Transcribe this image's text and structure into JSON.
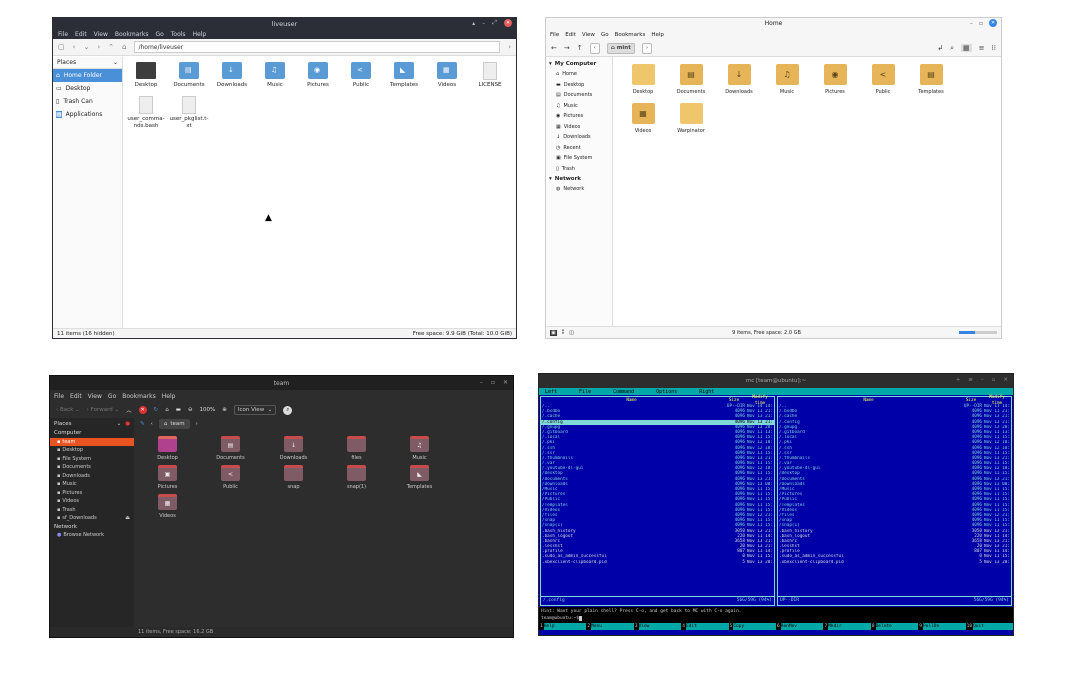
{
  "w1": {
    "title": "liveuser",
    "menu": [
      "File",
      "Edit",
      "View",
      "Bookmarks",
      "Go",
      "Tools",
      "Help"
    ],
    "path": "/home/liveuser",
    "places_label": "Places",
    "side": [
      "Home Folder",
      "Desktop",
      "Trash Can",
      "Applications"
    ],
    "items": [
      {
        "label": "Desktop",
        "kind": "dark"
      },
      {
        "label": "Documents",
        "kind": "folder",
        "glyph": "▤"
      },
      {
        "label": "Downloads",
        "kind": "folder",
        "glyph": "↓"
      },
      {
        "label": "Music",
        "kind": "folder",
        "glyph": "♫"
      },
      {
        "label": "Pictures",
        "kind": "folder",
        "glyph": "◉"
      },
      {
        "label": "Public",
        "kind": "folder",
        "glyph": "<"
      },
      {
        "label": "Templates",
        "kind": "folder",
        "glyph": "◣"
      },
      {
        "label": "Videos",
        "kind": "folder",
        "glyph": "▦"
      },
      {
        "label": "LICENSE",
        "kind": "doc"
      },
      {
        "label": "user_comma-nds.bash",
        "kind": "doc"
      },
      {
        "label": "user_pkglist.t-xt",
        "kind": "doc"
      }
    ],
    "status_left": "11 items (16 hidden)",
    "status_right": "Free space: 9.9 GiB (Total: 10.0 GiB)"
  },
  "w2": {
    "title": "Home",
    "menu": [
      "File",
      "Edit",
      "View",
      "Go",
      "Bookmarks",
      "Help"
    ],
    "crumb": "mint",
    "sections": [
      {
        "name": "My Computer",
        "items": [
          {
            "label": "Home",
            "icon": "home-icon",
            "glyph": "⌂"
          },
          {
            "label": "Desktop",
            "icon": "desktop-icon",
            "glyph": "▬"
          },
          {
            "label": "Documents",
            "icon": "documents-icon",
            "glyph": "▤"
          },
          {
            "label": "Music",
            "icon": "music-icon",
            "glyph": "♫"
          },
          {
            "label": "Pictures",
            "icon": "pictures-icon",
            "glyph": "◉"
          },
          {
            "label": "Videos",
            "icon": "videos-icon",
            "glyph": "▦"
          },
          {
            "label": "Downloads",
            "icon": "downloads-icon",
            "glyph": "↓"
          },
          {
            "label": "Recent",
            "icon": "recent-icon",
            "glyph": "◷"
          },
          {
            "label": "File System",
            "icon": "filesystem-icon",
            "glyph": "▣"
          },
          {
            "label": "Trash",
            "icon": "trash-icon",
            "glyph": "▯"
          }
        ]
      },
      {
        "name": "Network",
        "items": [
          {
            "label": "Network",
            "icon": "network-icon",
            "glyph": "◍"
          }
        ]
      }
    ],
    "items": [
      {
        "label": "Desktop",
        "glyph": ""
      },
      {
        "label": "Documents",
        "glyph": "▤"
      },
      {
        "label": "Downloads",
        "glyph": "↓"
      },
      {
        "label": "Music",
        "glyph": "♫"
      },
      {
        "label": "Pictures",
        "glyph": "◉"
      },
      {
        "label": "Public",
        "glyph": "<"
      },
      {
        "label": "Templates",
        "glyph": "▤"
      },
      {
        "label": "Videos",
        "glyph": "▦"
      },
      {
        "label": "Warpinator",
        "glyph": ""
      }
    ],
    "status": "9 items, Free space: 2.0 GB"
  },
  "w3": {
    "title": "team",
    "menu": [
      "File",
      "Edit",
      "View",
      "Go",
      "Bookmarks",
      "Help"
    ],
    "back": "Back",
    "forward": "Forward",
    "zoom": "100%",
    "view": "Icon View",
    "places_label": "Places",
    "tab": "team",
    "computer_label": "Computer",
    "side": [
      "team",
      "Desktop",
      "File System",
      "Documents",
      "Downloads",
      "Music",
      "Pictures",
      "Videos",
      "Trash",
      "sf_Downloads"
    ],
    "network_label": "Network",
    "network_item": "Browse Network",
    "items": [
      {
        "label": "Desktop",
        "glyph": "",
        "grad": true
      },
      {
        "label": "Documents",
        "glyph": "▤"
      },
      {
        "label": "Downloads",
        "glyph": "↓"
      },
      {
        "label": "files",
        "glyph": ""
      },
      {
        "label": "Music",
        "glyph": "♫"
      },
      {
        "label": "Pictures",
        "glyph": "▣"
      },
      {
        "label": "Public",
        "glyph": "<"
      },
      {
        "label": "snap",
        "glyph": ""
      },
      {
        "label": "snap(1)",
        "glyph": ""
      },
      {
        "label": "Templates",
        "glyph": "◣"
      },
      {
        "label": "Videos",
        "glyph": "▦"
      }
    ],
    "status": "11 items, Free space: 16.2 GB"
  },
  "w4": {
    "title": "mc [team@ubuntu]:~",
    "menu": [
      "Left",
      "File",
      "Command",
      "Options",
      "Right"
    ],
    "col_name": "Name",
    "col_size": "Size",
    "col_time": "Modify time",
    "left_rows": [
      {
        "n": "/..",
        "s": "UP--DIR",
        "t": "Nov 14 14:57"
      },
      {
        "n": "/.bsdbo",
        "s": "4096",
        "t": "Nov 11 21:22"
      },
      {
        "n": "/.cache",
        "s": "4096",
        "t": "Nov 13 21:46"
      },
      {
        "n": "/.config",
        "s": "4096",
        "t": "Nov 13 21:46",
        "sel": true
      },
      {
        "n": "/.gnupg",
        "s": "4096",
        "t": "Nov 13 20:42"
      },
      {
        "n": "/.gitboard",
        "s": "4096",
        "t": "Nov 11 13:18"
      },
      {
        "n": "/.local",
        "s": "4096",
        "t": "Nov 11 15:01"
      },
      {
        "n": "/.pki",
        "s": "4096",
        "t": "Nov 12 18:29"
      },
      {
        "n": "/.ssh",
        "s": "4096",
        "t": "Nov 12 18:29"
      },
      {
        "n": "/.ssr",
        "s": "4096",
        "t": "Nov 11 15:45"
      },
      {
        "n": "/.thumbnails",
        "s": "4096",
        "t": "Nov 13 21:43"
      },
      {
        "n": "/.var",
        "s": "4096",
        "t": "Nov 11 15:39"
      },
      {
        "n": "/.youtube-dl-gui",
        "s": "4096",
        "t": "Nov 12 18:02"
      },
      {
        "n": "/Desktop",
        "s": "4096",
        "t": "Nov 11 15:01"
      },
      {
        "n": "/Documents",
        "s": "4096",
        "t": "Nov 13 21:46"
      },
      {
        "n": "/Downloads",
        "s": "4096",
        "t": "Nov 13 00:24"
      },
      {
        "n": "/Music",
        "s": "4096",
        "t": "Nov 11 15:01"
      },
      {
        "n": "/Pictures",
        "s": "4096",
        "t": "Nov 11 15:01"
      },
      {
        "n": "/Public",
        "s": "4096",
        "t": "Nov 11 15:01"
      },
      {
        "n": "/Templates",
        "s": "4096",
        "t": "Nov 11 15:01"
      },
      {
        "n": "/Videos",
        "s": "4096",
        "t": "Nov 11 15:01"
      },
      {
        "n": "/files",
        "s": "4096",
        "t": "Nov 12 21:24"
      },
      {
        "n": "/snap",
        "s": "4096",
        "t": "Nov 11 15:33"
      },
      {
        "n": "/snap(1)",
        "s": "4096",
        "t": "Nov 11 15:32"
      },
      {
        "n": " .bash_history",
        "s": "3050",
        "t": "Nov 13 21:09"
      },
      {
        "n": " .bash_logout",
        "s": "220",
        "t": "Nov 11 14:57"
      },
      {
        "n": " .bashrc",
        "s": "3658",
        "t": "Nov 13 21:37"
      },
      {
        "n": " .lesshst",
        "s": "20",
        "t": "Nov 13 21:24"
      },
      {
        "n": " .profile",
        "s": "807",
        "t": "Nov 11 14:57"
      },
      {
        "n": " .sudo_as_admin_successful",
        "s": "0",
        "t": "Nov 11 15:00"
      },
      {
        "n": " .xbexclient-clipboard.pid",
        "s": "5",
        "t": "Nov 13 20:42"
      }
    ],
    "right_rows": [
      {
        "n": "/..",
        "s": "UP--DIR",
        "t": "Nov 11 14:57"
      },
      {
        "n": "/.bsdbo",
        "s": "4096",
        "t": "Nov 11 21:22"
      },
      {
        "n": "/.cache",
        "s": "4096",
        "t": "Nov 13 21:46"
      },
      {
        "n": "/.config",
        "s": "4096",
        "t": "Nov 13 21:46"
      },
      {
        "n": "/.gnupg",
        "s": "4096",
        "t": "Nov 13 20:42"
      },
      {
        "n": "/.gitboard",
        "s": "4096",
        "t": "Nov 11 13:18"
      },
      {
        "n": "/.local",
        "s": "4096",
        "t": "Nov 11 15:01"
      },
      {
        "n": "/.pki",
        "s": "4096",
        "t": "Nov 12 18:29"
      },
      {
        "n": "/.ssh",
        "s": "4096",
        "t": "Nov 12 18:29"
      },
      {
        "n": "/.ssr",
        "s": "4096",
        "t": "Nov 11 15:45"
      },
      {
        "n": "/.thumbnails",
        "s": "4096",
        "t": "Nov 13 21:43"
      },
      {
        "n": "/.var",
        "s": "4096",
        "t": "Nov 11 15:39"
      },
      {
        "n": "/.youtube-dl-gui",
        "s": "4096",
        "t": "Nov 12 18:02"
      },
      {
        "n": "/Desktop",
        "s": "4096",
        "t": "Nov 11 15:01"
      },
      {
        "n": "/Documents",
        "s": "4096",
        "t": "Nov 13 21:46"
      },
      {
        "n": "/Downloads",
        "s": "4096",
        "t": "Nov 13 00:24"
      },
      {
        "n": "/Music",
        "s": "4096",
        "t": "Nov 11 15:01"
      },
      {
        "n": "/Pictures",
        "s": "4096",
        "t": "Nov 11 15:01"
      },
      {
        "n": "/Public",
        "s": "4096",
        "t": "Nov 11 15:01"
      },
      {
        "n": "/Templates",
        "s": "4096",
        "t": "Nov 11 15:01"
      },
      {
        "n": "/Videos",
        "s": "4096",
        "t": "Nov 11 15:01"
      },
      {
        "n": "/files",
        "s": "4096",
        "t": "Nov 12 21:24"
      },
      {
        "n": "/snap",
        "s": "4096",
        "t": "Nov 11 15:33"
      },
      {
        "n": "/snap(1)",
        "s": "4096",
        "t": "Nov 11 15:32"
      },
      {
        "n": " .bash_history",
        "s": "3050",
        "t": "Nov 13 21:09"
      },
      {
        "n": " .bash_logout",
        "s": "220",
        "t": "Nov 11 14:57"
      },
      {
        "n": " .bashrc",
        "s": "3658",
        "t": "Nov 13 21:37"
      },
      {
        "n": " .lesshst",
        "s": "20",
        "t": "Nov 13 21:24"
      },
      {
        "n": " .profile",
        "s": "807",
        "t": "Nov 11 14:57"
      },
      {
        "n": " .sudo_as_admin_successful",
        "s": "0",
        "t": "Nov 11 15:00"
      },
      {
        "n": " .xbexclient-clipboard.pid",
        "s": "5",
        "t": "Nov 13 20:42"
      }
    ],
    "left_foot_name": "/.config",
    "left_foot_info": "56G/59G (94%)",
    "right_foot_name": "UP--DIR",
    "right_foot_info": "56G/59G (94%)",
    "hint": "Hint: Want your plain shell? Press C-o, and get back to MC with C-o again.",
    "prompt": "team@ubuntu:~$ ",
    "fkeys": [
      {
        "k": "1",
        "l": "Help"
      },
      {
        "k": "2",
        "l": "Menu"
      },
      {
        "k": "3",
        "l": "View"
      },
      {
        "k": "4",
        "l": "Edit"
      },
      {
        "k": "5",
        "l": "Copy"
      },
      {
        "k": "6",
        "l": "RenMov"
      },
      {
        "k": "7",
        "l": "Mkdir"
      },
      {
        "k": "8",
        "l": "Delete"
      },
      {
        "k": "9",
        "l": "PullDn"
      },
      {
        "k": "10",
        "l": "Quit"
      }
    ]
  }
}
